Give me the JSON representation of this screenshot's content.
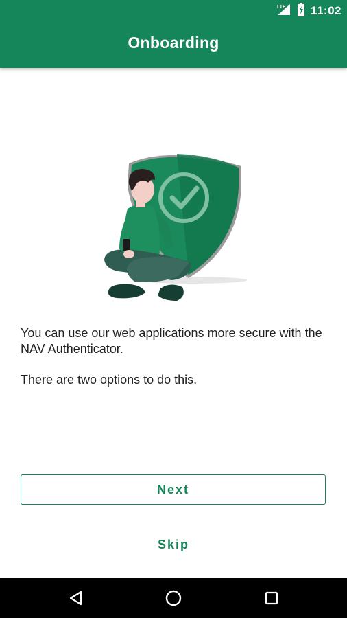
{
  "status_bar": {
    "time": "11:02",
    "network_label": "LTE",
    "icons": [
      "lte-signal-icon",
      "battery-charging-icon"
    ]
  },
  "app_bar": {
    "title": "Onboarding",
    "color": "#15855a"
  },
  "illustration": {
    "icon": "person-with-shield-illustration"
  },
  "content": {
    "paragraph1": "You can use our web applications more secure with the NAV Authenticator.",
    "paragraph2": "There are two options to do this."
  },
  "actions": {
    "next_label": "Next",
    "skip_label": "Skip"
  },
  "nav_bar": {
    "icons": [
      "back-triangle-icon",
      "home-circle-icon",
      "recents-square-icon"
    ]
  }
}
